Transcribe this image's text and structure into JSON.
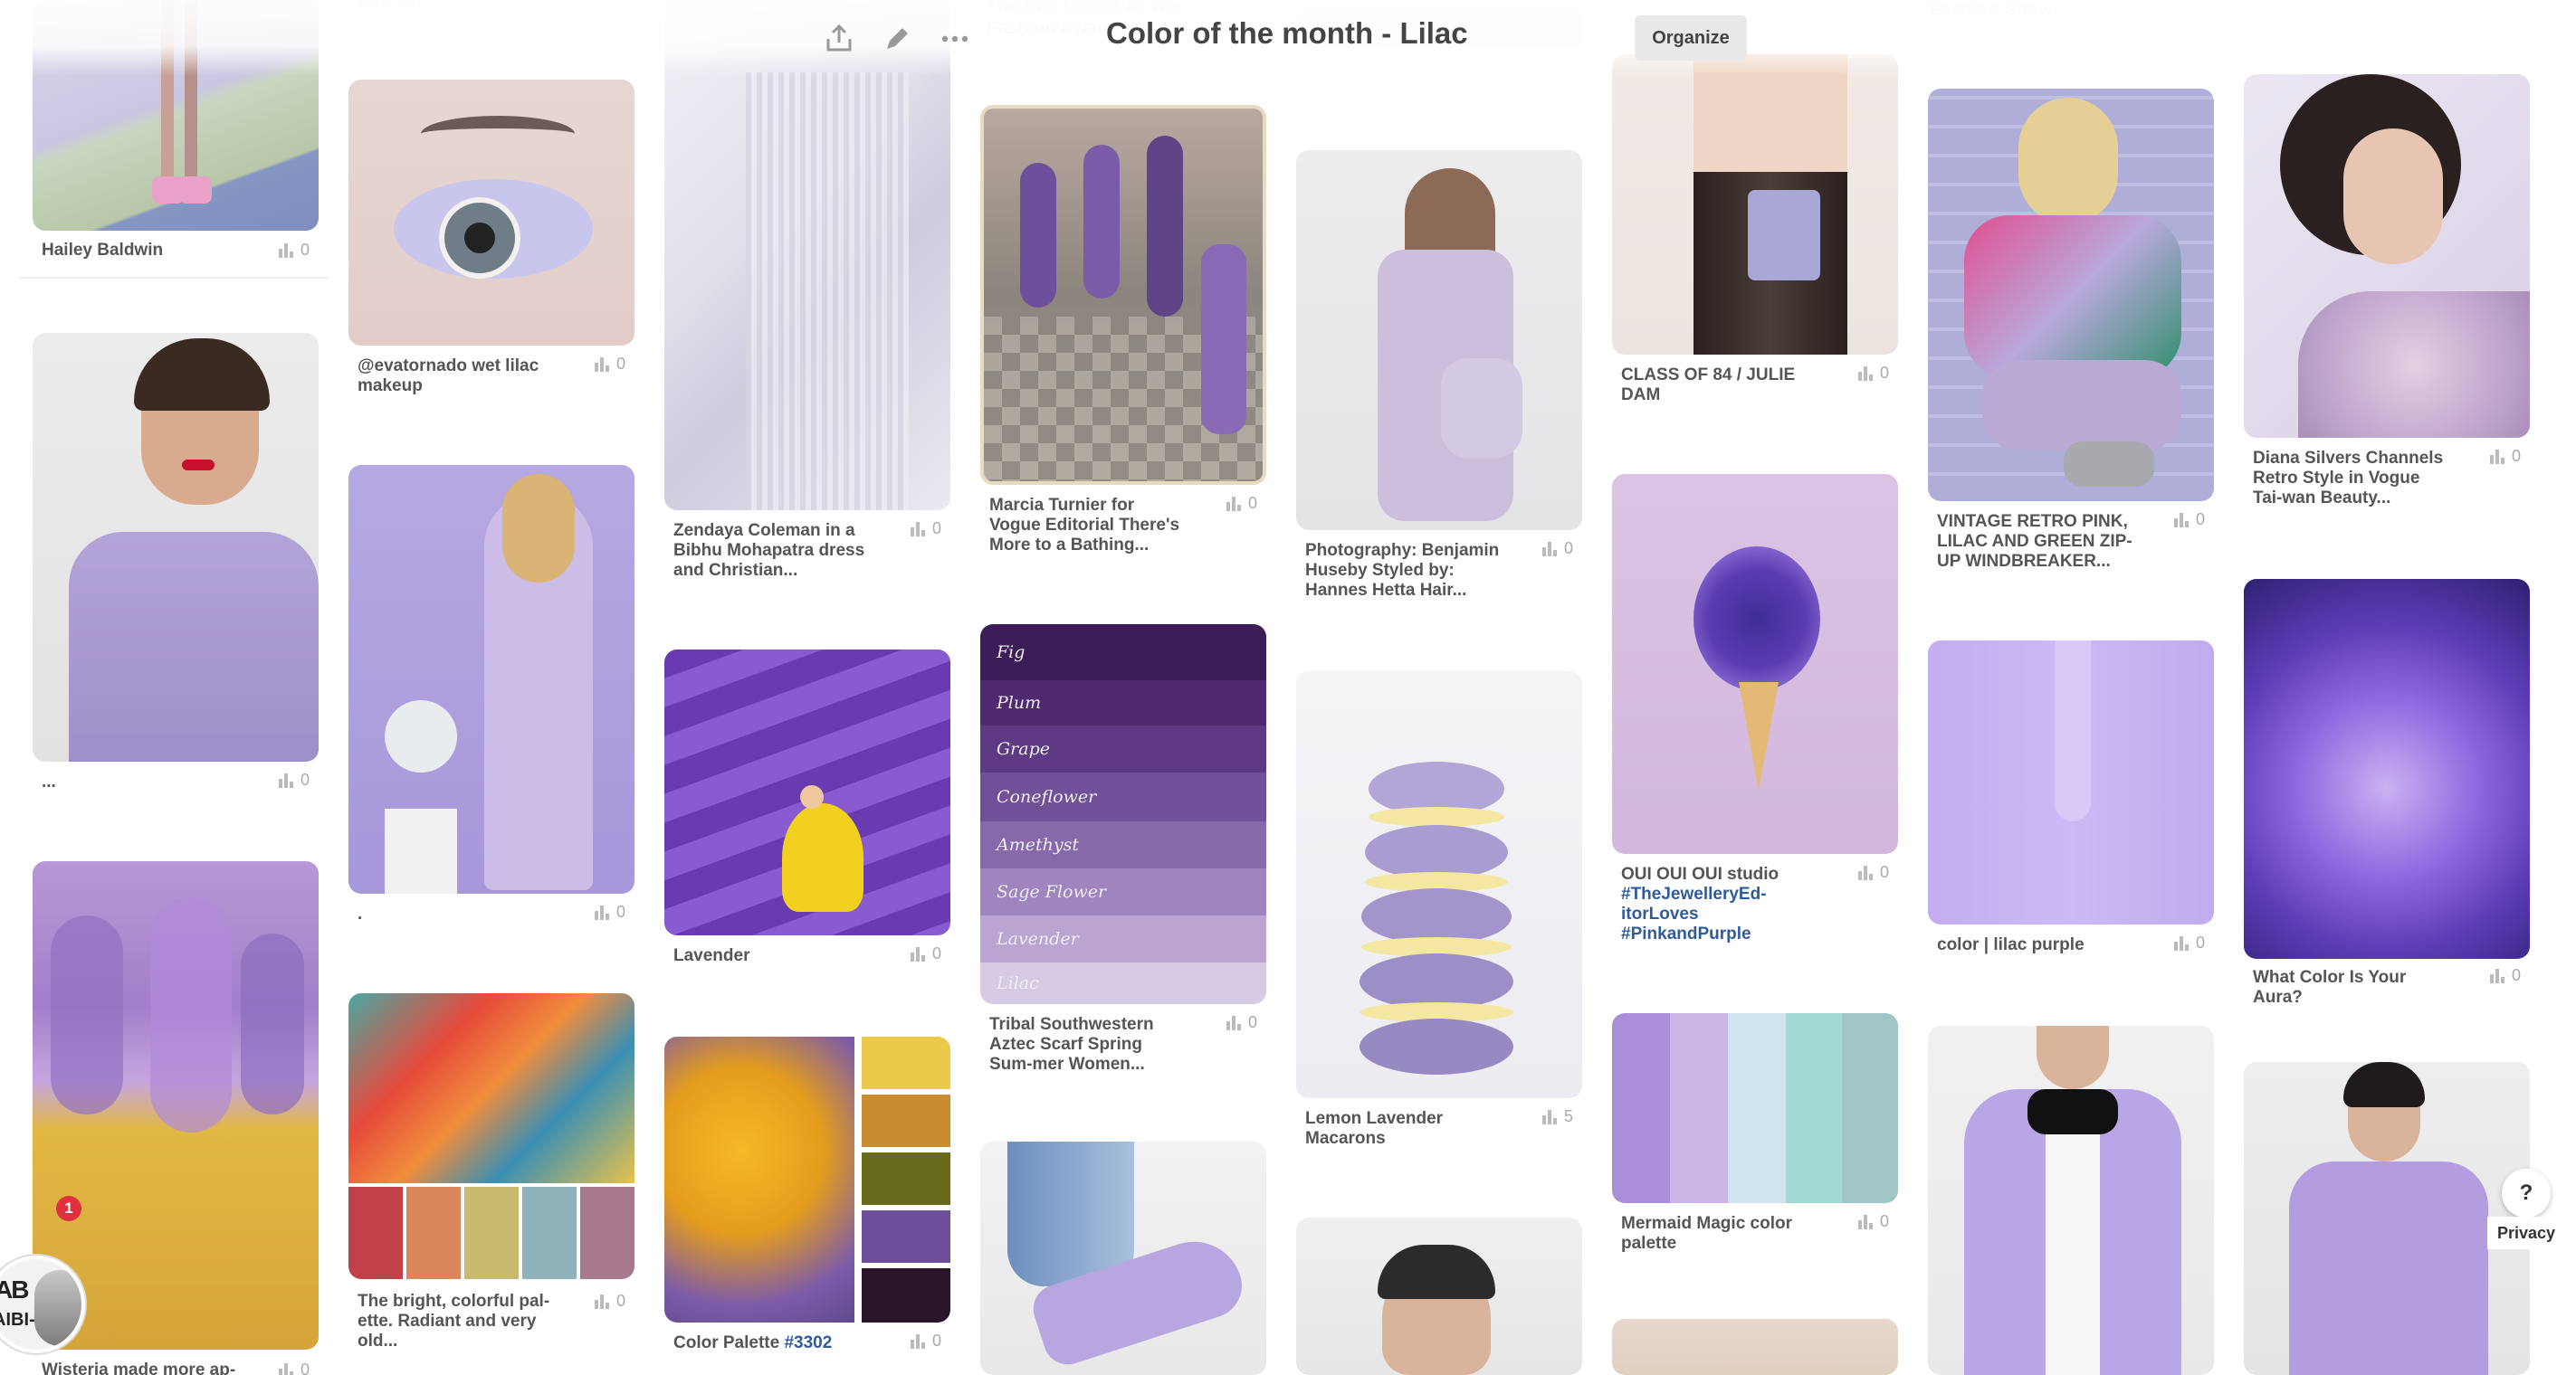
{
  "header": {
    "title": "Color of the month - Lilac",
    "organize_label": "Organize",
    "faint_texts": [
      "Hail ver...",
      "The Red Carpet At The",
      "Fashion Award...",
      "Fashion Show"
    ]
  },
  "pins": {
    "p1": {
      "caption": "Hailey Baldwin",
      "count": "0"
    },
    "p2": {
      "caption": "...",
      "count": "0"
    },
    "p3": {
      "caption": "Wisteria made more ap-",
      "count": "0"
    },
    "p4": {
      "caption": "@evatornado wet lilac makeup",
      "count": "0"
    },
    "p5": {
      "caption": ".",
      "count": "0"
    },
    "p6": {
      "caption": "The bright, colorful pal-ette. Radiant and very old...",
      "count": "0"
    },
    "p7": {
      "caption": "Zendaya Coleman in a Bibhu Mohapatra dress and Christian...",
      "count": "0"
    },
    "p8": {
      "caption": "Lavender",
      "count": "0"
    },
    "p9": {
      "caption": "Color Palette ",
      "caption_tag": "#3302",
      "count": "0"
    },
    "p10": {
      "caption": "Marcia Turnier for Vogue Editorial There's More to a Bathing...",
      "count": "0"
    },
    "p11": {
      "caption": "Tribal Southwestern Aztec Scarf Spring Sum-mer Women...",
      "count": "0"
    },
    "p12": {
      "caption": "Photography: Benjamin Huseby Styled by: Hannes Hetta Hair...",
      "count": "0"
    },
    "p13": {
      "caption": "Lemon Lavender Macarons",
      "count": "5"
    },
    "p14": {
      "caption": "CLASS OF 84 / JULIE DAM",
      "count": "0"
    },
    "p15": {
      "caption": "OUI OUI OUI studio ",
      "caption_tag": "#TheJewelleryEd-itorLoves #PinkandPurple",
      "count": "0"
    },
    "p16": {
      "caption": "Mermaid Magic color palette",
      "count": "0"
    },
    "p17": {
      "caption": "VINTAGE RETRO PINK, LILAC AND GREEN ZIP-UP WINDBREAKER...",
      "count": "0"
    },
    "p18": {
      "caption": "color | lilac purple",
      "count": "0"
    },
    "p19": {
      "caption": "Diana Silvers Channels Retro Style in Vogue Tai-wan Beauty...",
      "count": "0"
    },
    "p20": {
      "caption": "What Color Is Your Aura?",
      "count": "0"
    }
  },
  "palette_names": [
    "Fig",
    "Plum",
    "Grape",
    "Coneflower",
    "Amethyst",
    "Sage Flower",
    "Lavender",
    "Lilac"
  ],
  "colors": {
    "lilac": "#b9a4e0",
    "lavender": "#7d5cb8",
    "link": "#2f5b9a",
    "badge": "#e0303d"
  },
  "avatar": {
    "logo": "AB",
    "logo_sub": "AIBI-",
    "notification_count": "1"
  },
  "help_label": "?",
  "privacy_label": "Privacy"
}
